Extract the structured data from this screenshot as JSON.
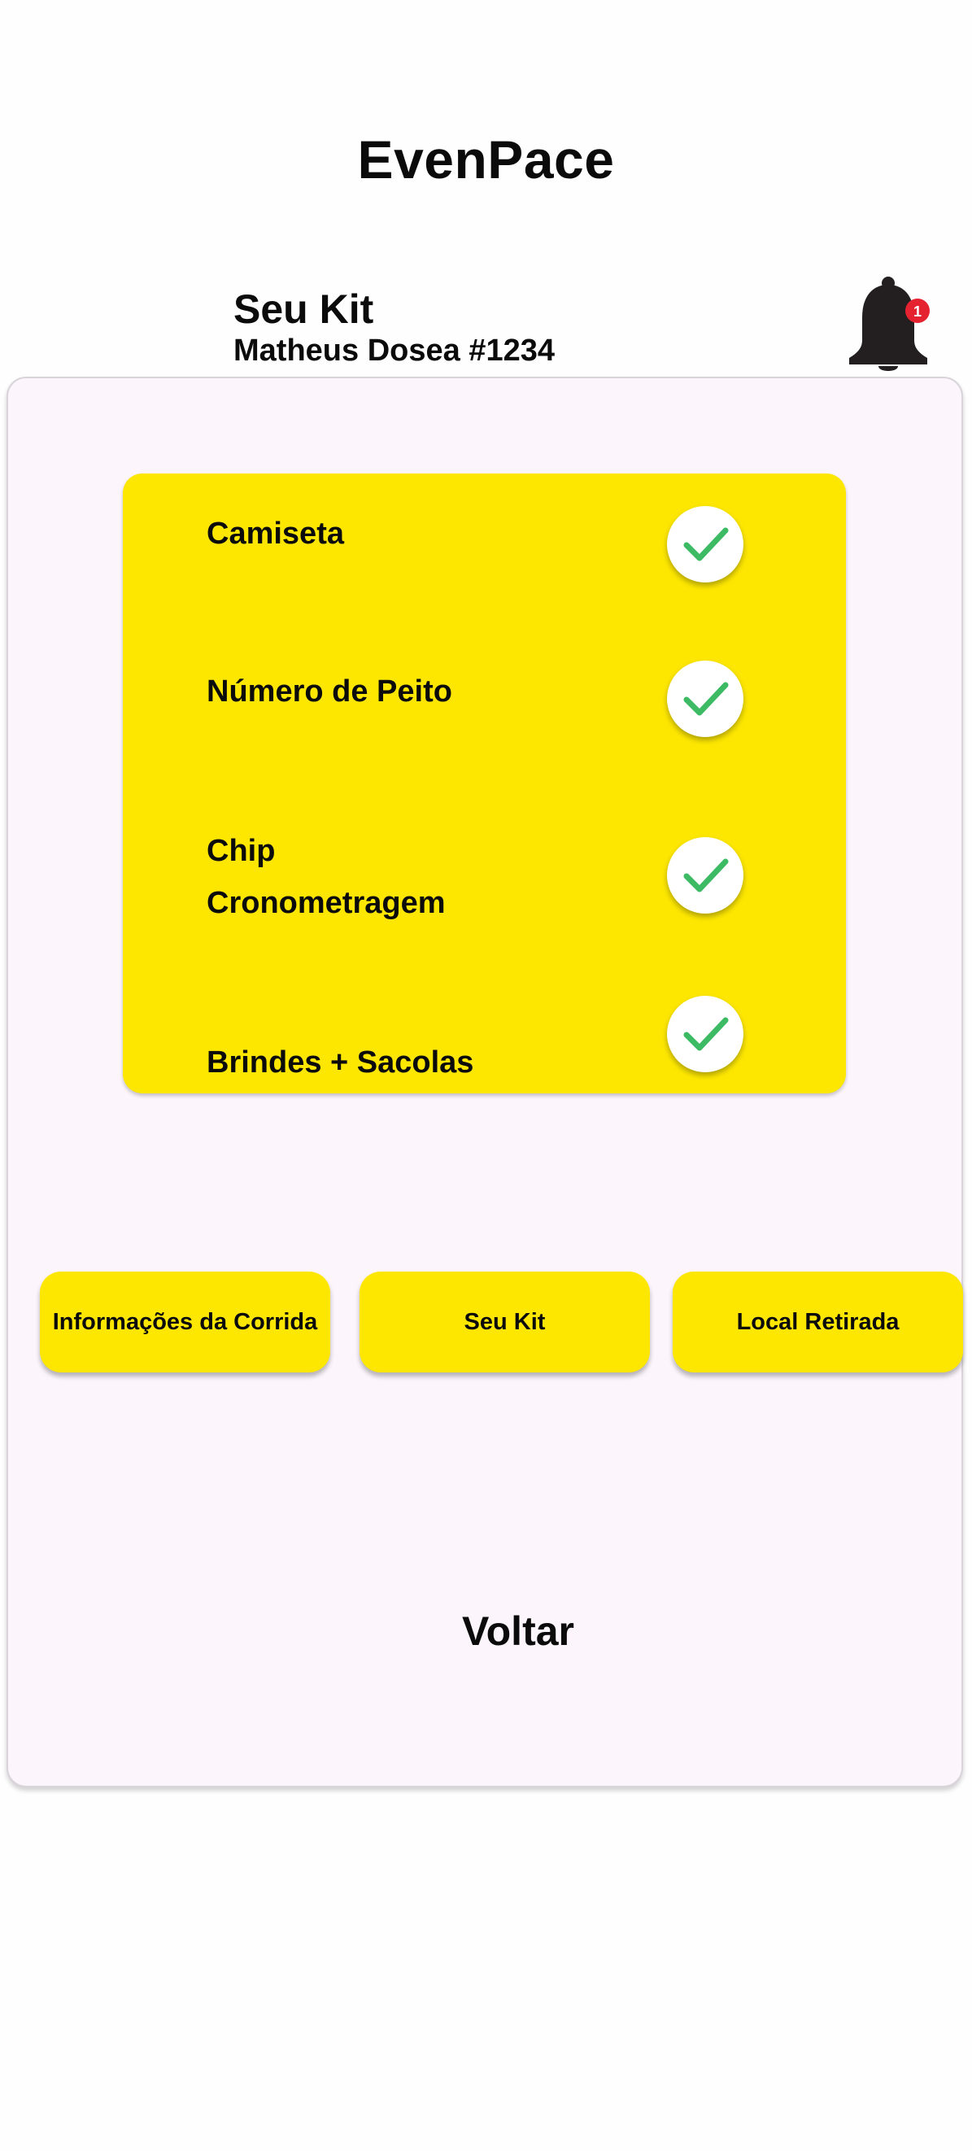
{
  "app": {
    "title": "EvenPace"
  },
  "header": {
    "title": "Seu Kit",
    "subtitle": "Matheus Dosea #1234",
    "notifications": {
      "icon": "bell-icon",
      "count": "1",
      "badge_color": "#e52330"
    }
  },
  "kit": {
    "panel_color": "#fde700",
    "check_color": "#3dbb64",
    "items": [
      {
        "label": "Camiseta",
        "status": "checked"
      },
      {
        "label": "Número de Peito",
        "status": "checked"
      },
      {
        "label_line1": "Chip",
        "label_line2": "Cronometragem",
        "status": "checked"
      },
      {
        "label": "Brindes + Sacolas",
        "status": "checked"
      }
    ]
  },
  "nav": {
    "race_info_label": "Informações da Corrida",
    "kit_label": "Seu Kit",
    "pickup_label": "Local Retirada"
  },
  "back_label": "Voltar"
}
